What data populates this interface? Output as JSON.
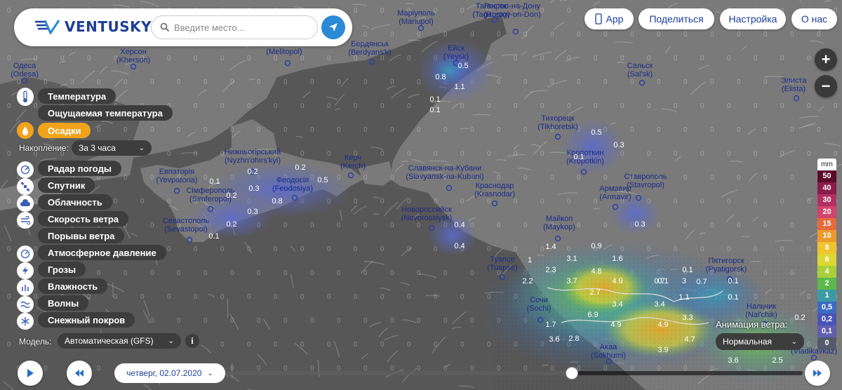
{
  "app": {
    "name": "VENTUSKY"
  },
  "search": {
    "placeholder": "Введите место..."
  },
  "top_nav": {
    "app": "App",
    "share": "Поделиться",
    "settings": "Настройка",
    "about": "О нас"
  },
  "layers": {
    "temperature": "Температура",
    "feels_like": "Ощущаемая температура",
    "precipitation": "Осадки",
    "radar": "Радар погоды",
    "satellite": "Спутник",
    "clouds": "Облачность",
    "wind_speed": "Скорость ветра",
    "wind_gusts": "Порывы ветра",
    "pressure": "Атмосферное давление",
    "thunderstorms": "Грозы",
    "humidity": "Влажность",
    "waves": "Волны",
    "snow_cover": "Снежный покров"
  },
  "accumulation": {
    "label": "Накопление:",
    "value": "За 3 часа"
  },
  "model": {
    "label": "Модель:",
    "value": "Автоматическая (GFS)"
  },
  "date": {
    "value": "четверг, 02.07.2020"
  },
  "timeline": {
    "progress": 0.6
  },
  "wind_animation": {
    "label": "Анимация ветра:",
    "value": "Нормальная"
  },
  "legend": {
    "unit": "mm",
    "steps": [
      {
        "label": "50",
        "color": "#5b0a2a"
      },
      {
        "label": "40",
        "color": "#8a1c4a"
      },
      {
        "label": "30",
        "color": "#b22f63"
      },
      {
        "label": "20",
        "color": "#d2446b"
      },
      {
        "label": "15",
        "color": "#e56b3e"
      },
      {
        "label": "10",
        "color": "#ed9a2c"
      },
      {
        "label": "8",
        "color": "#f0c430"
      },
      {
        "label": "6",
        "color": "#dcd734"
      },
      {
        "label": "4",
        "color": "#a8d03a"
      },
      {
        "label": "2",
        "color": "#5cb94a"
      },
      {
        "label": "1",
        "color": "#3a9aa8"
      },
      {
        "label": "0,5",
        "color": "#3b6bbf"
      },
      {
        "label": "0,2",
        "color": "#4a53b5"
      },
      {
        "label": "0,1",
        "color": "#5f5fae"
      },
      {
        "label": "0",
        "color": "#555a6a"
      }
    ]
  },
  "cities": [
    {
      "name": "Одеса",
      "latin": "(Odesa)"
    },
    {
      "name": "Херсон",
      "latin": "(Kherson)"
    },
    {
      "name": "Маріуполь",
      "latin": "(Mariupol)"
    },
    {
      "name": "Таганрог",
      "latin": "(Taganrog)"
    },
    {
      "name": "Ростов-на-Дону",
      "latin": "(Rostov-on-Don)"
    },
    {
      "name": "Бердянськ",
      "latin": "(Berdyans'k)"
    },
    {
      "name": "",
      "latin": "(Melitopol)"
    },
    {
      "name": "Ейск",
      "latin": "(Yeysk)"
    },
    {
      "name": "Сальск",
      "latin": "(Sal'sk)"
    },
    {
      "name": "Элиста",
      "latin": "(Elista)"
    },
    {
      "name": "Тихорецк",
      "latin": "(Tikhoretsk)"
    },
    {
      "name": "Кропоткин",
      "latin": "(Kropotkin)"
    },
    {
      "name": "Нижньогірський",
      "latin": "(Nyzhn'ohirs'kyi)"
    },
    {
      "name": "Керч",
      "latin": "(Kerch)"
    },
    {
      "name": "Славянск-на-Кубани",
      "latin": "(Slavyansk-na-Kubani)"
    },
    {
      "name": "Евпаторія",
      "latin": "(Yevpatoria)"
    },
    {
      "name": "Феодосія",
      "latin": "(Feodosiya)"
    },
    {
      "name": "Краснодар",
      "latin": "(Krasnodar)"
    },
    {
      "name": "Армавир",
      "latin": "(Armavir)"
    },
    {
      "name": "Ставрополь",
      "latin": "(Stavropol)"
    },
    {
      "name": "Сімферополь",
      "latin": "(Simferopol)"
    },
    {
      "name": "Новороссийск",
      "latin": "(Novorossiysk)"
    },
    {
      "name": "Севастополь",
      "latin": "(Sevastopol)"
    },
    {
      "name": "Майкоп",
      "latin": "(Maykop)"
    },
    {
      "name": "Туапсе",
      "latin": "(Tuapse)"
    },
    {
      "name": "Пятигорск",
      "latin": "(Pyatigorsk)"
    },
    {
      "name": "Сочи",
      "latin": "(Sochi)"
    },
    {
      "name": "Нальчик",
      "latin": "(Nal'chik)"
    },
    {
      "name": "",
      "latin": "(Vladikavkaz)"
    },
    {
      "name": "Акаа",
      "latin": "(Sokhumi)"
    }
  ],
  "precip_values": [
    "0.5",
    "1.1",
    "0.8",
    "0.1",
    "0.1",
    "0.5",
    "0.2",
    "0.2",
    "0.1",
    "0.2",
    "0.5",
    "0.3",
    "0.3",
    "0.8",
    "0.3",
    "0.2",
    "0.1",
    "0.1",
    "0.3",
    "0.4",
    "0.4",
    "1.4",
    "0.9",
    "1",
    "3.1",
    "1.6",
    "2.3",
    "4.8",
    "2.2",
    "3.7",
    "2.7",
    "4.9",
    "3",
    "3.4",
    "3.4",
    "0.7",
    "1.1",
    "0.1",
    "0.1",
    "6.9",
    "4.9",
    "1.7",
    "4.9",
    "3.6",
    "2.8",
    "3.9",
    "4.7",
    "3.3",
    "3.6",
    "2.5",
    "2.5",
    "0.2",
    "0.7",
    "0.1",
    "0.1",
    "1"
  ]
}
